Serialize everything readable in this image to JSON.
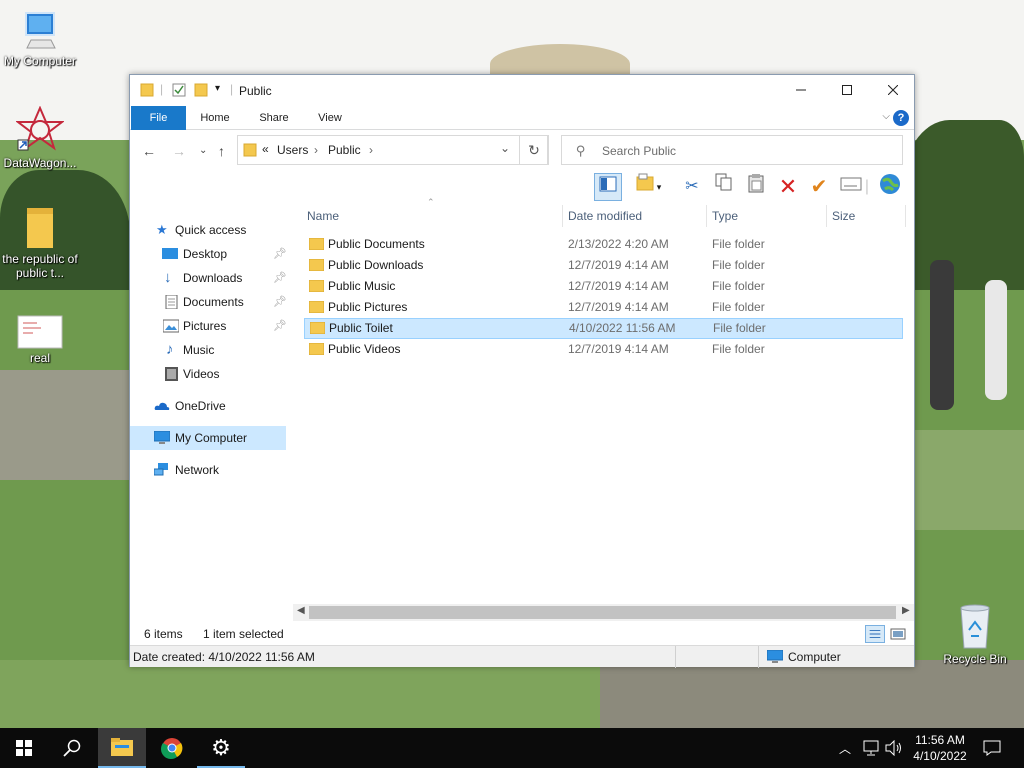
{
  "desktop": {
    "icons": [
      {
        "label": "My Computer"
      },
      {
        "label": "DataWagon..."
      },
      {
        "label": "the republic of public t..."
      },
      {
        "label": "real"
      },
      {
        "label": "Recycle Bin"
      }
    ]
  },
  "explorer": {
    "title": "Public",
    "quick_access_toolbar": [
      "folder-icon",
      "properties-icon",
      "new-folder-icon",
      "customize-dropdown-icon"
    ],
    "ribbon_tabs": {
      "file": "File",
      "home": "Home",
      "share": "Share",
      "view": "View"
    },
    "address": {
      "overflow": "«",
      "segments": [
        "Users",
        "Public"
      ]
    },
    "search": {
      "placeholder": "Search Public"
    },
    "toolbar_icons": [
      "preview-pane-icon",
      "new-folder-icon",
      "cut-icon",
      "copy-icon",
      "paste-icon",
      "delete-icon",
      "checkmark-icon",
      "rename-icon",
      "web-icon"
    ],
    "nav": {
      "quick_access": "Quick access",
      "items": [
        {
          "label": "Desktop",
          "pinned": true
        },
        {
          "label": "Downloads",
          "pinned": true
        },
        {
          "label": "Documents",
          "pinned": true
        },
        {
          "label": "Pictures",
          "pinned": true
        },
        {
          "label": "Music",
          "pinned": false
        },
        {
          "label": "Videos",
          "pinned": false
        }
      ],
      "onedrive": "OneDrive",
      "my_computer": "My Computer",
      "network": "Network"
    },
    "columns": {
      "name": "Name",
      "date": "Date modified",
      "type": "Type",
      "size": "Size"
    },
    "files": [
      {
        "name": "Public Documents",
        "date": "2/13/2022 4:20 AM",
        "type": "File folder",
        "size": ""
      },
      {
        "name": "Public Downloads",
        "date": "12/7/2019 4:14 AM",
        "type": "File folder",
        "size": ""
      },
      {
        "name": "Public Music",
        "date": "12/7/2019 4:14 AM",
        "type": "File folder",
        "size": ""
      },
      {
        "name": "Public Pictures",
        "date": "12/7/2019 4:14 AM",
        "type": "File folder",
        "size": ""
      },
      {
        "name": "Public Toilet",
        "date": "4/10/2022 11:56 AM",
        "type": "File folder",
        "size": "",
        "selected": true
      },
      {
        "name": "Public Videos",
        "date": "12/7/2019 4:14 AM",
        "type": "File folder",
        "size": ""
      }
    ],
    "status": {
      "items": "6 items",
      "selected": "1 item selected"
    },
    "details": {
      "date_created": "Date created: 4/10/2022 11:56 AM",
      "location": "Computer"
    }
  },
  "taskbar": {
    "buttons": [
      "start-icon",
      "search-icon",
      "file-explorer-icon",
      "chrome-icon",
      "settings-icon"
    ],
    "clock": {
      "time": "11:56 AM",
      "date": "4/10/2022"
    }
  },
  "colors": {
    "accent": "#1979ca",
    "selection": "#cce8ff",
    "taskbar": "#0b0b0b"
  }
}
